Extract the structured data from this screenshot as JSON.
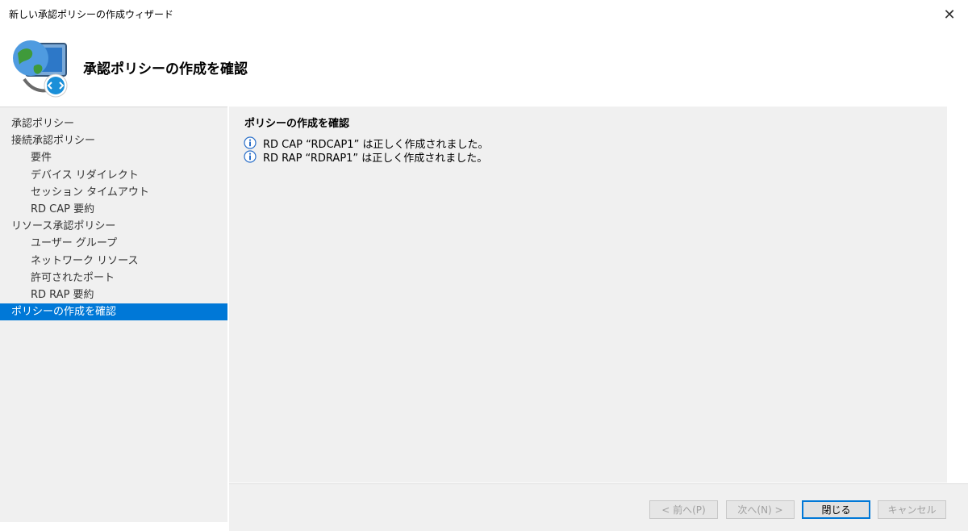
{
  "window": {
    "title": "新しい承認ポリシーの作成ウィザード",
    "close_glyph": "✕"
  },
  "header": {
    "heading": "承認ポリシーの作成を確認",
    "icon": "remote-desktop-gateway-icon"
  },
  "sidebar": {
    "items": [
      {
        "label": "承認ポリシー",
        "level": 0,
        "selected": false
      },
      {
        "label": "接続承認ポリシー",
        "level": 0,
        "selected": false
      },
      {
        "label": "要件",
        "level": 1,
        "selected": false
      },
      {
        "label": "デバイス リダイレクト",
        "level": 1,
        "selected": false
      },
      {
        "label": "セッション タイムアウト",
        "level": 1,
        "selected": false
      },
      {
        "label": "RD CAP 要約",
        "level": 1,
        "selected": false
      },
      {
        "label": "リソース承認ポリシー",
        "level": 0,
        "selected": false
      },
      {
        "label": "ユーザー グループ",
        "level": 1,
        "selected": false
      },
      {
        "label": "ネットワーク リソース",
        "level": 1,
        "selected": false
      },
      {
        "label": "許可されたポート",
        "level": 1,
        "selected": false
      },
      {
        "label": "RD RAP 要約",
        "level": 1,
        "selected": false
      },
      {
        "label": "ポリシーの作成を確認",
        "level": 0,
        "selected": true
      }
    ]
  },
  "content": {
    "section_title": "ポリシーの作成を確認",
    "messages": [
      {
        "icon": "info-icon",
        "text": "RD CAP “RDCAP1” は正しく作成されました。"
      },
      {
        "icon": "info-icon",
        "text": "RD RAP “RDRAP1” は正しく作成されました。"
      }
    ]
  },
  "footer": {
    "back_label": "< 前へ(P)",
    "next_label": "次へ(N) >",
    "close_label": "閉じる",
    "cancel_label": "キャンセル"
  },
  "colors": {
    "selection": "#0078d7",
    "panel": "#f0f0f0"
  }
}
